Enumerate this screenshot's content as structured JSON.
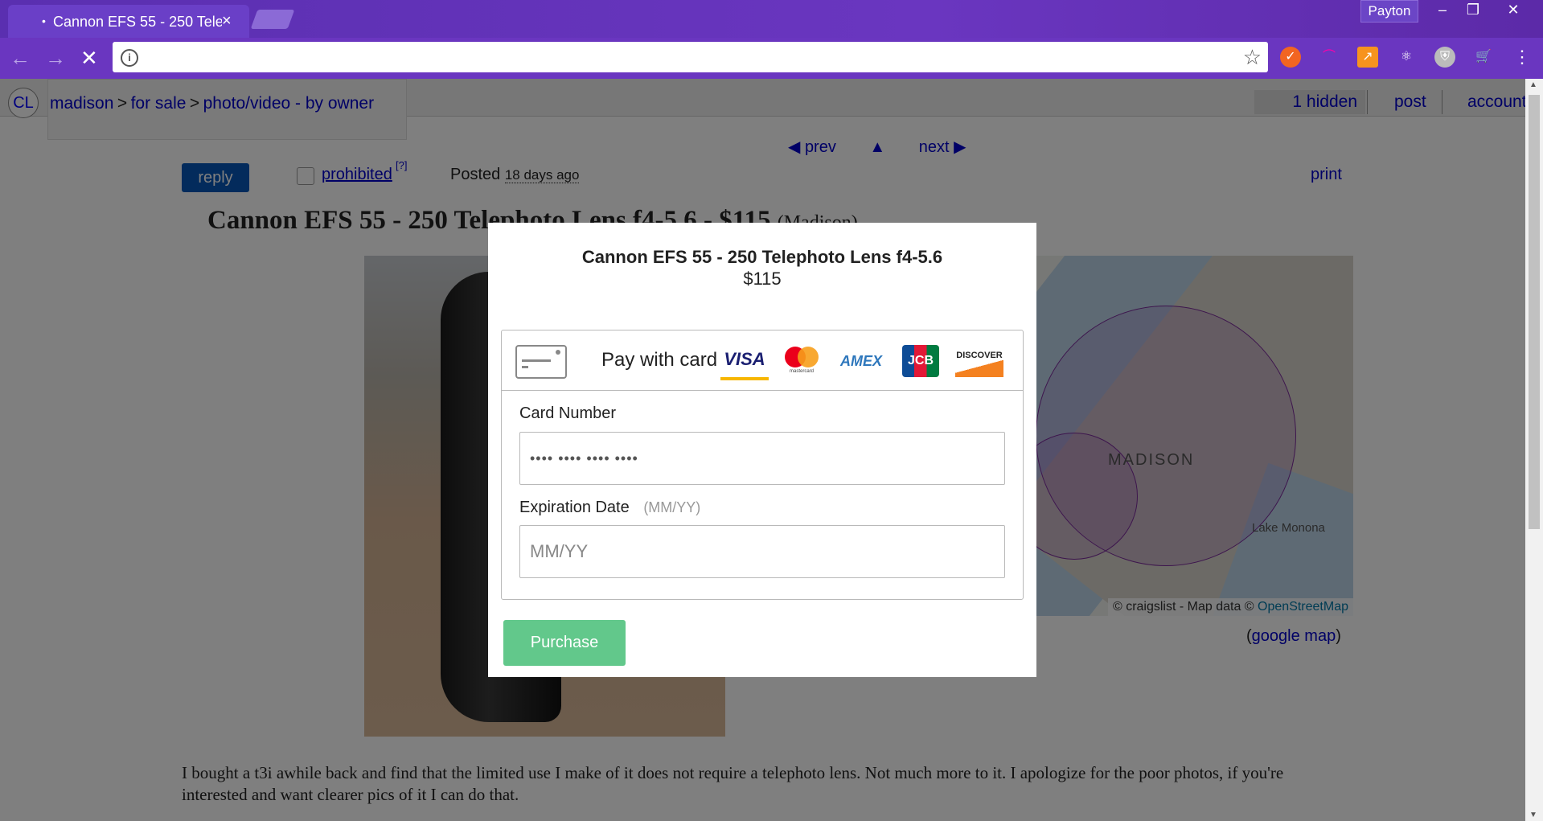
{
  "browser": {
    "tab_title": "Cannon EFS 55 - 250 Tele",
    "profile_name": "Payton",
    "url": ""
  },
  "header": {
    "logo": "CL",
    "breadcrumb": [
      "madison",
      "for sale",
      "photo/video - by owner"
    ],
    "breadcrumb_sep": ">",
    "hidden": "1 hidden",
    "post": "post",
    "account": "account"
  },
  "posting_nav": {
    "prev": "◀ prev",
    "up": "▲",
    "next": "next ▶"
  },
  "actions": {
    "reply": "reply",
    "prohibited": "prohibited",
    "prohibited_help": "[?]",
    "posted_label": "Posted",
    "posted_when": "18 days ago",
    "print": "print"
  },
  "posting": {
    "title": "Cannon EFS 55 - 250 Telephoto Lens f4-5.6 - $115",
    "location": "(Madison)",
    "description": "I bought a t3i awhile back and find that the limited use I make of it does not require a telephoto lens. Not much more to it. I apologize for the poor photos, if you're interested and want clearer pics of it I can do that."
  },
  "map": {
    "city_label": "MADISON",
    "lake_label": "Lake Monona",
    "attribution_prefix": "© craigslist - Map data ©",
    "attribution_link": "OpenStreetMap",
    "google_map_open": "(",
    "google_map": "google map",
    "google_map_close": ")"
  },
  "modal": {
    "title": "Cannon EFS 55 - 250 Telephoto Lens f4-5.6",
    "price": "$115",
    "pay_label": "Pay with card",
    "brands": {
      "visa": "VISA",
      "mastercard": "mastercard",
      "amex": "AMEX",
      "jcb": "JCB",
      "discover": "DISCOVER"
    },
    "card_number_label": "Card Number",
    "card_number_placeholder": "•••• •••• •••• ••••",
    "expiration_label": "Expiration Date",
    "expiration_hint": "(MM/YY)",
    "expiration_placeholder": "MM/YY",
    "purchase": "Purchase"
  },
  "colors": {
    "browser_theme": "#6a36c0",
    "link": "#0000cc",
    "reply_button": "#0757b8",
    "purchase_button": "#62c88b"
  }
}
